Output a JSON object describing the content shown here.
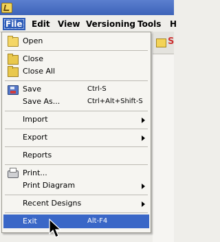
{
  "menubar": {
    "items": [
      {
        "label": "File",
        "active": true
      },
      {
        "label": "Edit",
        "active": false
      },
      {
        "label": "View",
        "active": false
      },
      {
        "label": "Versioning",
        "active": false
      },
      {
        "label": "Tools",
        "active": false
      },
      {
        "label": "H",
        "active": false
      }
    ]
  },
  "file_menu": {
    "items": [
      {
        "label": "Open",
        "icon": "folder-open-icon"
      },
      {
        "label": "Close",
        "icon": "folder-icon"
      },
      {
        "label": "Close All",
        "icon": "folder-icon"
      },
      {
        "label": "Save",
        "icon": "save-disk-icon",
        "shortcut": "Ctrl-S"
      },
      {
        "label": "Save As...",
        "shortcut": "Ctrl+Alt+Shift-S"
      },
      {
        "label": "Import",
        "submenu": true
      },
      {
        "label": "Export",
        "submenu": true
      },
      {
        "label": "Reports"
      },
      {
        "label": "Print...",
        "icon": "printer-icon"
      },
      {
        "label": "Print Diagram",
        "submenu": true
      },
      {
        "label": "Recent Designs",
        "submenu": true
      },
      {
        "label": "Exit",
        "shortcut": "Alt-F4",
        "selected": true
      }
    ]
  },
  "toolbar": {
    "partial_glyph": "S"
  },
  "colors": {
    "selection": "#3a67c7",
    "menubar_active": "#2c5bb8",
    "menu_bg": "#f6f5f1"
  }
}
